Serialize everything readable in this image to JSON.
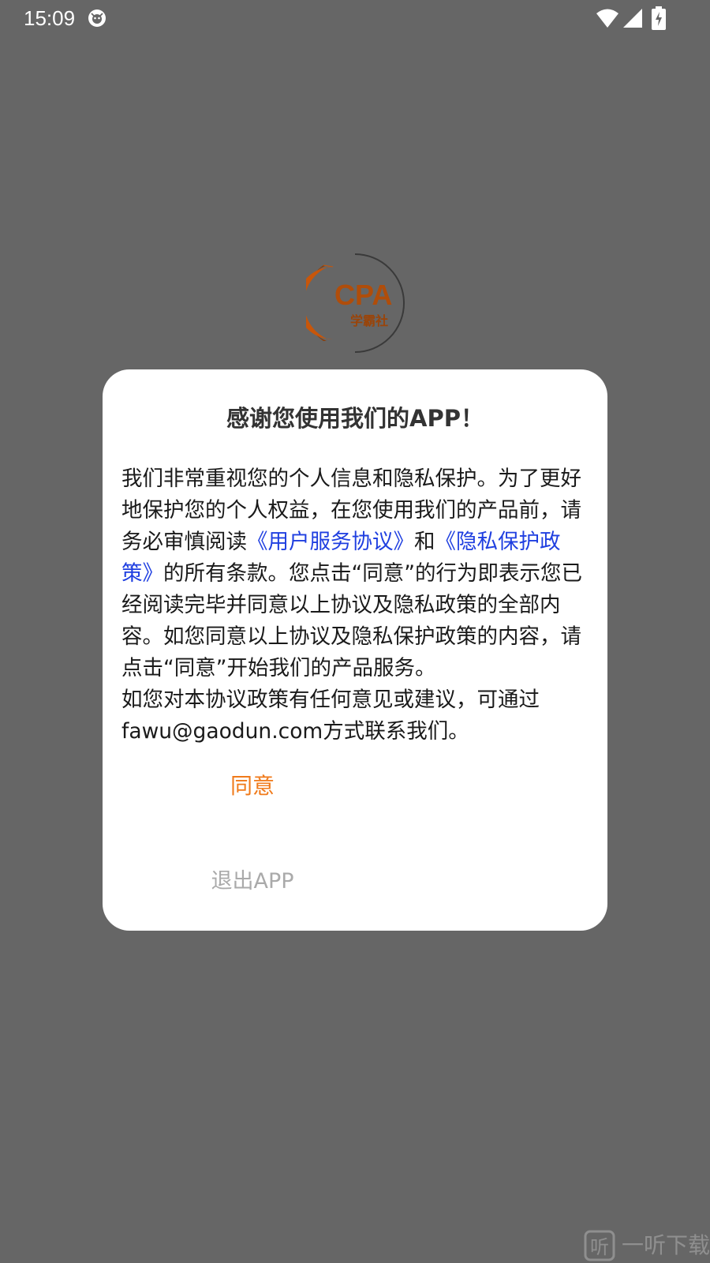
{
  "status_bar": {
    "time": "15:09",
    "icons": [
      "app-notification-icon",
      "wifi-icon",
      "cellular-signal-icon",
      "battery-charging-icon"
    ]
  },
  "splash": {
    "logo_text": "CPA",
    "logo_subtext": "学霸社",
    "brand_color": "#c8560a"
  },
  "dialog": {
    "title": "感谢您使用我们的APP！",
    "body": {
      "p1": "我们非常重视您的个人信息和隐私保护。为了更好地保护您的个人权益，在您使用我们的产品前，请务必审慎阅读",
      "link_user_agreement": "《用户服务协议》",
      "p2": "和",
      "link_privacy_policy": "《隐私保护政策》",
      "p3": "的所有条款。您点击“同意”的行为即表示您已经阅读完毕并同意以上协议及隐私政策的全部内容。如您同意以上协议及隐私保护政策的内容，请点击“同意”开始我们的产品服务。",
      "p4": "如您对本协议政策有任何意见或建议，可通过fawu@gaodun.com方式联系我们。"
    },
    "agree_label": "同意",
    "exit_label": "退出APP"
  },
  "watermark": {
    "text": "一听下载"
  },
  "colors": {
    "backdrop": "#666666",
    "link": "#1f3fe0",
    "agree": "#f07a1a",
    "exit": "#aaaaaa"
  }
}
